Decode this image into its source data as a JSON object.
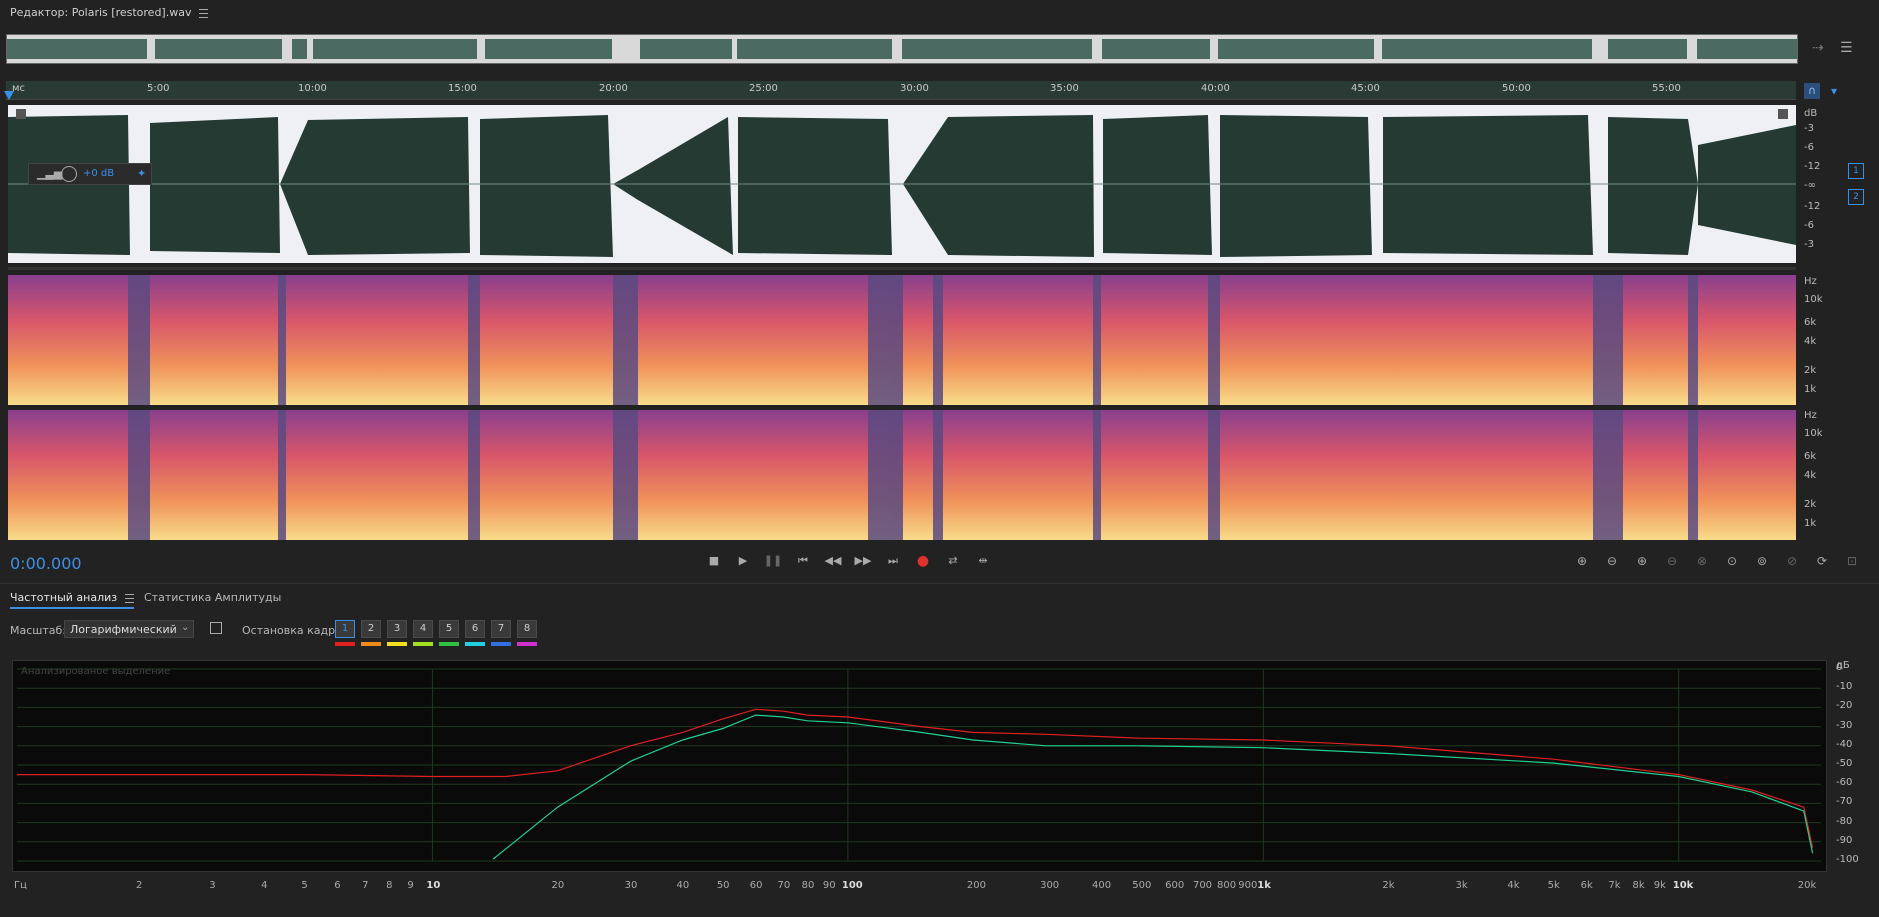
{
  "window": {
    "title": "Редактор: Polaris [restored].wav"
  },
  "ruler": {
    "labels": [
      "мс",
      "5:00",
      "10:00",
      "15:00",
      "20:00",
      "25:00",
      "30:00",
      "35:00",
      "40:00",
      "45:00",
      "50:00",
      "55:00"
    ]
  },
  "waveform": {
    "gain": "+0 dB",
    "db_labels": [
      "dB",
      "-3",
      "-6",
      "-12",
      "-∞",
      "-12",
      "-6",
      "-3"
    ],
    "channels": [
      "1",
      "2"
    ]
  },
  "spectrogram": {
    "unit": "Hz",
    "labels": [
      "10k",
      "6k",
      "4k",
      "2k",
      "1k"
    ]
  },
  "transport": {
    "timecode": "0:00.000"
  },
  "panel": {
    "tabs": [
      "Частотный анализ",
      "Статистика Амплитуды"
    ],
    "scale_label": "Масштаб:",
    "scale_value": "Логарифмический",
    "hold_label": "Остановка кадра:",
    "frames": [
      "1",
      "2",
      "3",
      "4",
      "5",
      "6",
      "7",
      "8"
    ],
    "frame_colors": [
      "#e02020",
      "#f08a18",
      "#f0e020",
      "#a0e020",
      "#30c040",
      "#20d0e0",
      "#3070e0",
      "#d030d0"
    ],
    "selection_label": "Анализированое выделение"
  },
  "chart_data": {
    "type": "line",
    "x_scale": "log",
    "y_unit": "дБ",
    "x_unit": "Гц",
    "ylim": [
      -100,
      0
    ],
    "yticks": [
      "дБ",
      "0",
      "-10",
      "-20",
      "-30",
      "-40",
      "-50",
      "-60",
      "-70",
      "-80",
      "-90",
      "-100"
    ],
    "xticks": [
      "Гц",
      "2",
      "3",
      "4",
      "5",
      "6",
      "7",
      "8",
      "9",
      "10",
      "20",
      "30",
      "40",
      "50",
      "60",
      "70",
      "80",
      "90",
      "100",
      "200",
      "300",
      "400",
      "500",
      "600",
      "700",
      "800",
      "900",
      "1k",
      "2k",
      "3k",
      "4k",
      "5k",
      "6k",
      "7k",
      "8k",
      "9k",
      "10k",
      "20k"
    ],
    "series": [
      {
        "color": "#e02020",
        "x": [
          1,
          5,
          10,
          15,
          20,
          30,
          40,
          50,
          60,
          70,
          80,
          100,
          150,
          200,
          300,
          500,
          1000,
          2000,
          5000,
          10000,
          15000,
          20000,
          21000
        ],
        "y": [
          -55,
          -55,
          -56,
          -56,
          -53,
          -40,
          -33,
          -26,
          -21,
          -22,
          -24,
          -25,
          -30,
          -33,
          -34,
          -36,
          -37,
          -40,
          -47,
          -55,
          -63,
          -72,
          -93
        ]
      },
      {
        "color": "#20d090",
        "x": [
          14,
          20,
          30,
          40,
          50,
          60,
          70,
          80,
          100,
          150,
          200,
          300,
          500,
          1000,
          2000,
          5000,
          10000,
          15000,
          20000,
          21000
        ],
        "y": [
          -99,
          -72,
          -48,
          -37,
          -31,
          -24,
          -25,
          -27,
          -28,
          -33,
          -37,
          -40,
          -40,
          -41,
          -44,
          -49,
          -56,
          -64,
          -74,
          -96
        ]
      }
    ]
  }
}
